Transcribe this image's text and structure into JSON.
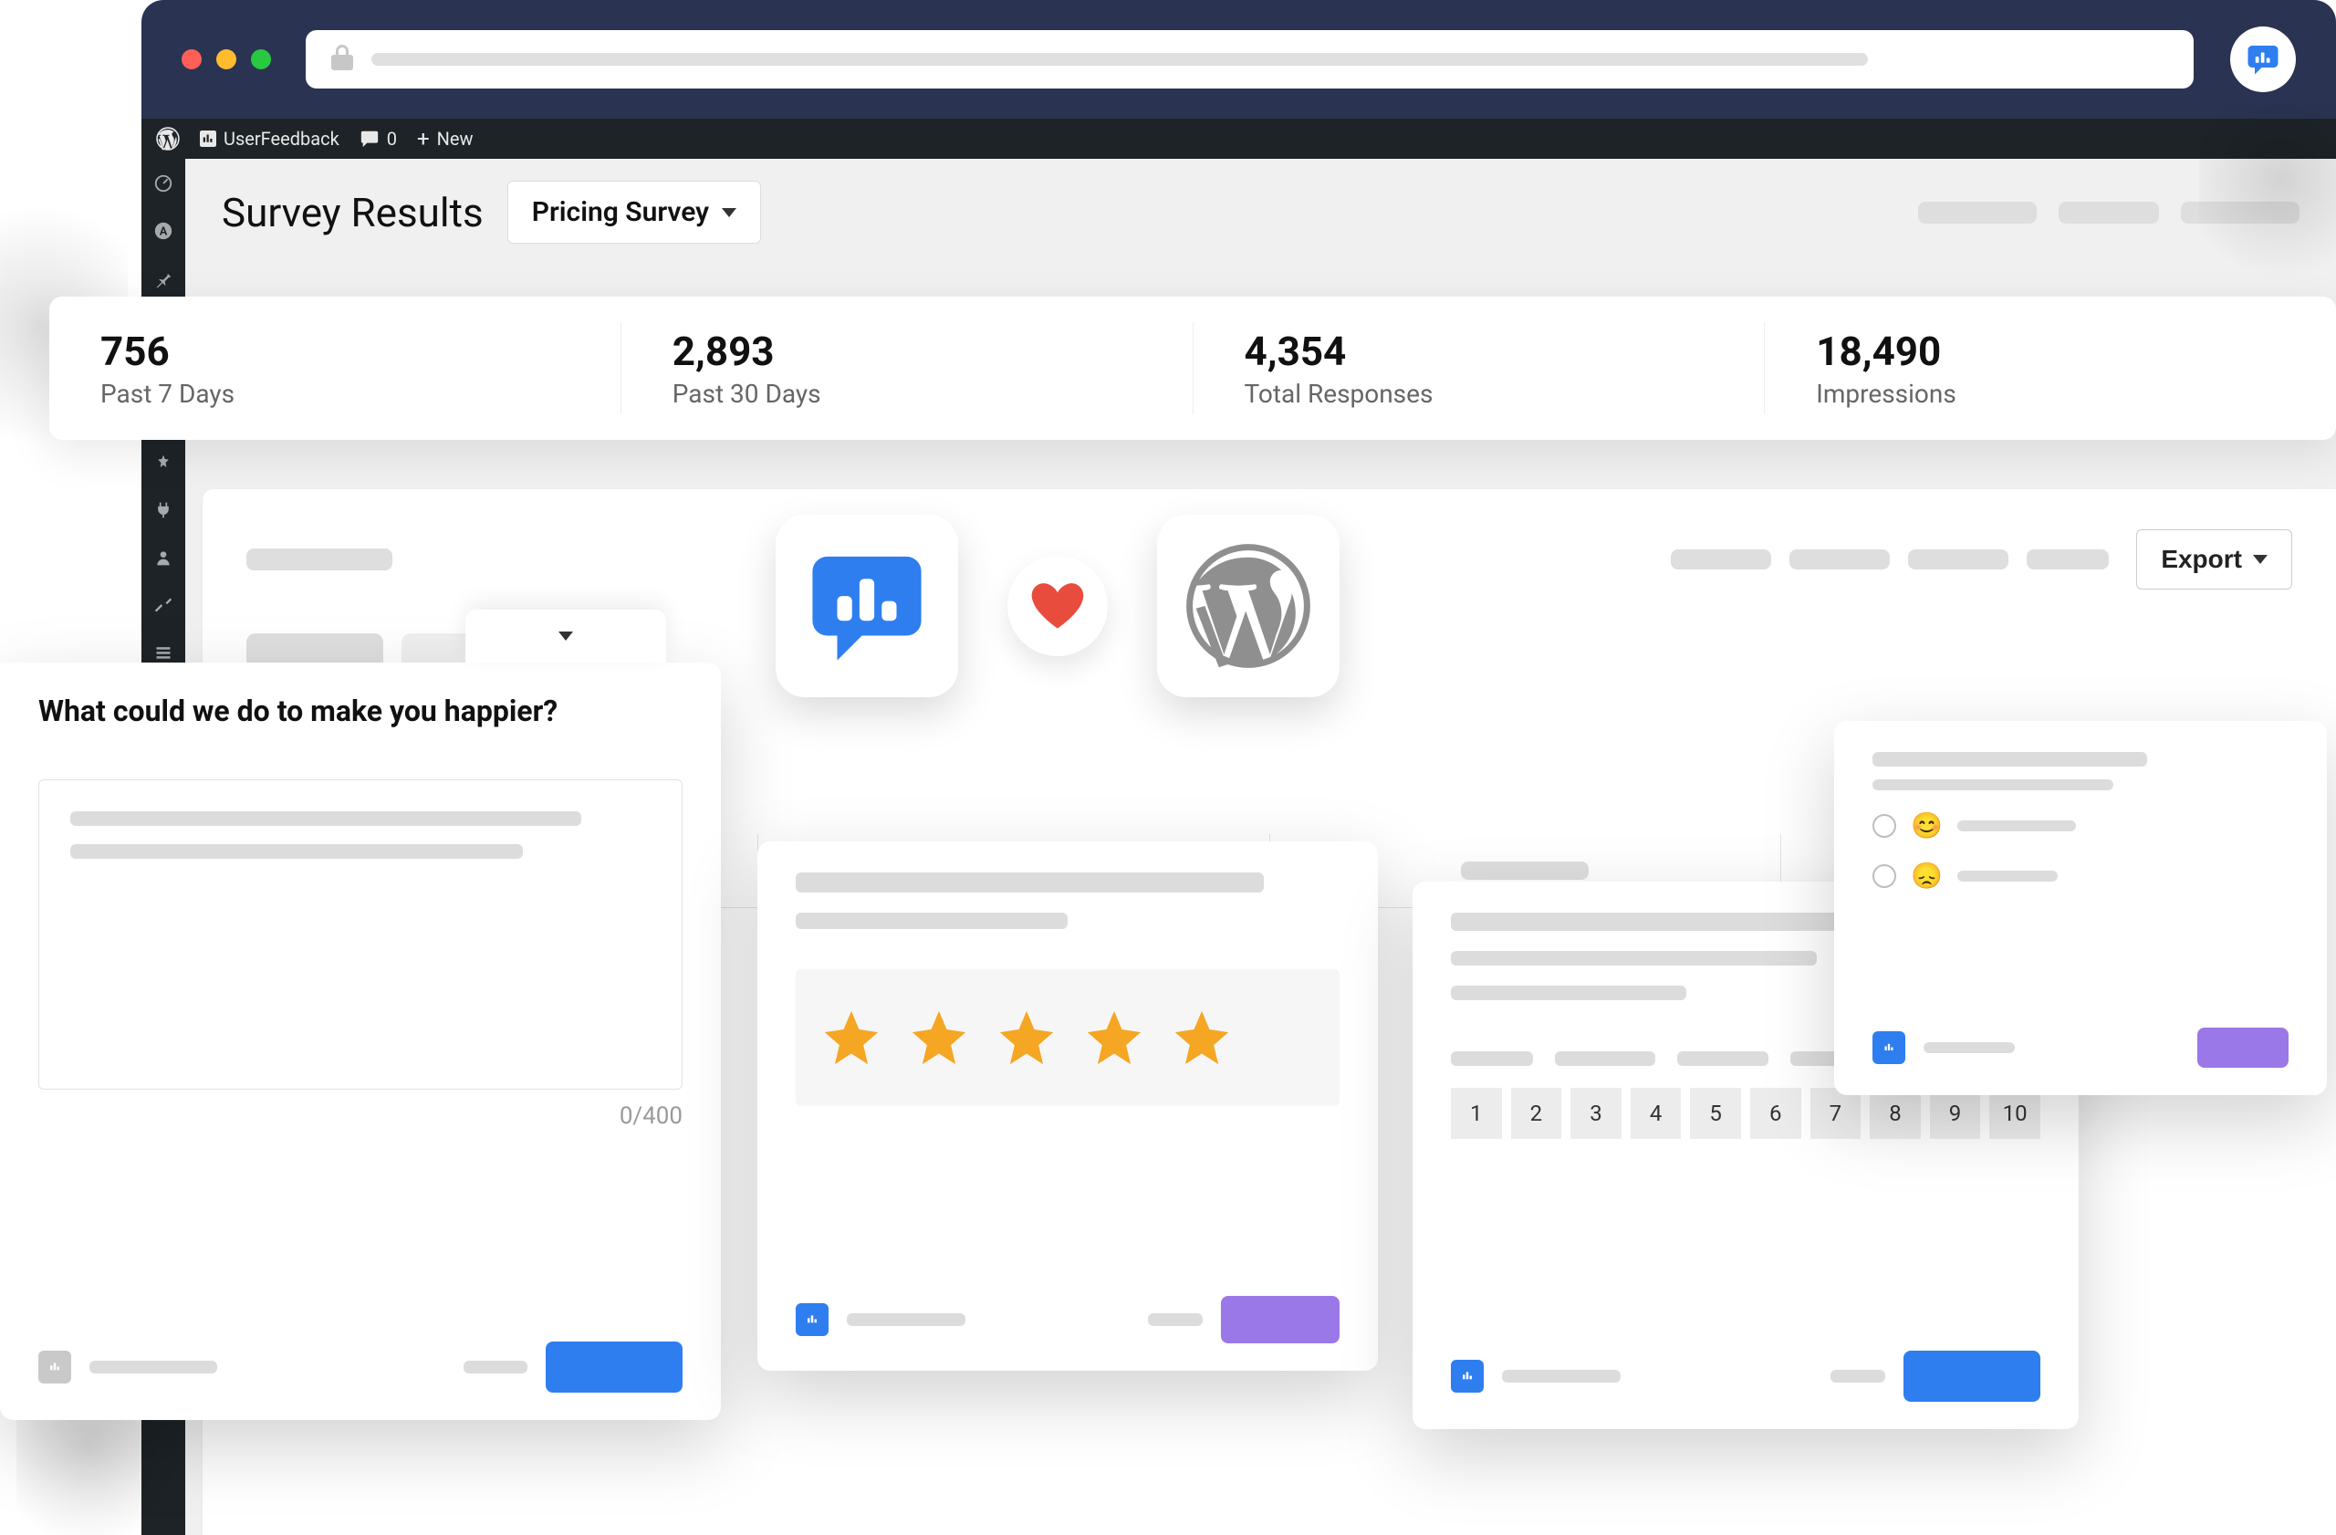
{
  "browser": {
    "brand_icon": "userfeedback-icon"
  },
  "wp_admin_bar": {
    "site_label": "UserFeedback",
    "comments_count": "0",
    "new_label": "New"
  },
  "page": {
    "title": "Survey Results",
    "survey_selected": "Pricing Survey",
    "export_label": "Export"
  },
  "stats": [
    {
      "value": "756",
      "label": "Past 7 Days"
    },
    {
      "value": "2,893",
      "label": "Past 30 Days"
    },
    {
      "value": "4,354",
      "label": "Total Responses"
    },
    {
      "value": "18,490",
      "label": "Impressions"
    }
  ],
  "card_text": {
    "question": "What could we do to make you happier?",
    "char_count": "0/400"
  },
  "card_stars": {
    "rating": 5
  },
  "card_nps": {
    "scale": [
      "1",
      "2",
      "3",
      "4",
      "5",
      "6",
      "7",
      "8",
      "9",
      "10"
    ]
  },
  "card_emoji": {
    "options": [
      {
        "emoji": "😊"
      },
      {
        "emoji": "😞"
      }
    ]
  },
  "colors": {
    "brand_blue": "#2e7ef0",
    "accent_purple": "#9b78e8",
    "star": "#f5a623",
    "heart": "#e84c3d"
  }
}
